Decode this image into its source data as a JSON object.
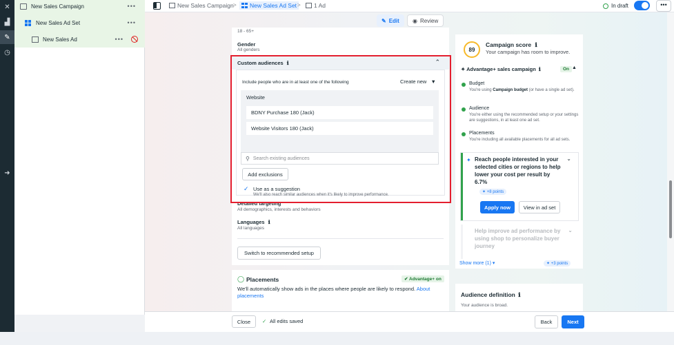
{
  "rail": {
    "icons": [
      "close-icon",
      "chart-icon",
      "pencil-icon",
      "history-icon",
      "arrow-right-icon"
    ]
  },
  "tree": {
    "campaign": "New Sales Campaign",
    "adset": "New Sales Ad Set",
    "ad": "New Sales Ad",
    "more": "•••"
  },
  "topbar": {
    "crumb_campaign": "New Sales Campaign",
    "crumb_adset": "New Sales Ad Set",
    "crumb_ad": "1 Ad",
    "sep": ">",
    "status": "In draft",
    "more": "•••"
  },
  "modes": {
    "edit": "Edit",
    "review": "Review"
  },
  "audience": {
    "age": "18 - 65+",
    "gender_label": "Gender",
    "gender_value": "All genders",
    "custom_title": "Custom audiences",
    "include_text": "Include people who are in at least one of the following",
    "create_new": "Create new",
    "website_label": "Website",
    "items": [
      "BDNY Purchase 180 (Jack)",
      "Website Visitors 180 (Jack)"
    ],
    "search_placeholder": "Search existing audiences",
    "add_exclusions": "Add exclusions",
    "use_suggestion": "Use as a suggestion",
    "suggestion_note": "We'll also reach similar audiences when it's likely to improve performance.",
    "detailed_label": "Detailed targeting",
    "detailed_value": "All demographics, interests and behaviors",
    "languages_label": "Languages",
    "languages_value": "All languages",
    "switch_button": "Switch to recommended setup"
  },
  "placements": {
    "title": "Placements",
    "badge": "✔ Advantage+ on",
    "text": "We'll automatically show ads in the places where people are likely to respond.",
    "link": "About placements"
  },
  "score": {
    "value": "89",
    "title": "Campaign score",
    "subtitle": "Your campaign has room to improve.",
    "advantage_title": "Advantage+ sales campaign",
    "advantage_badge": "On",
    "checks": [
      {
        "title": "Budget",
        "text1": "You're using",
        "bold": "Campaign budget",
        "text2": "(or have a single ad set)."
      },
      {
        "title": "Audience",
        "text1": "You're either using the recommended setup or your settings are suggestions, in at least one ad set."
      },
      {
        "title": "Placements",
        "text1": "You're including all available placements for all ad sets."
      }
    ],
    "suggestion_title": "Reach people interested in your selected cities or regions to help lower your cost per result by 6.7%",
    "suggestion_points": "+8 points",
    "apply_now": "Apply now",
    "view_in_adset": "View in ad set",
    "faded_title": "Help improve ad performance by using shop to personalize buyer journey",
    "show_more": "Show more (1)",
    "more_points": "+3 points"
  },
  "definition": {
    "title": "Audience definition",
    "text": "Your audience is broad."
  },
  "footer": {
    "close": "Close",
    "saved": "All edits saved",
    "back": "Back",
    "next": "Next"
  },
  "colors": {
    "accent": "#1877f2",
    "success": "#31a24c",
    "highlight_frame": "#e41e2e",
    "score_ring": "#f7b928"
  }
}
